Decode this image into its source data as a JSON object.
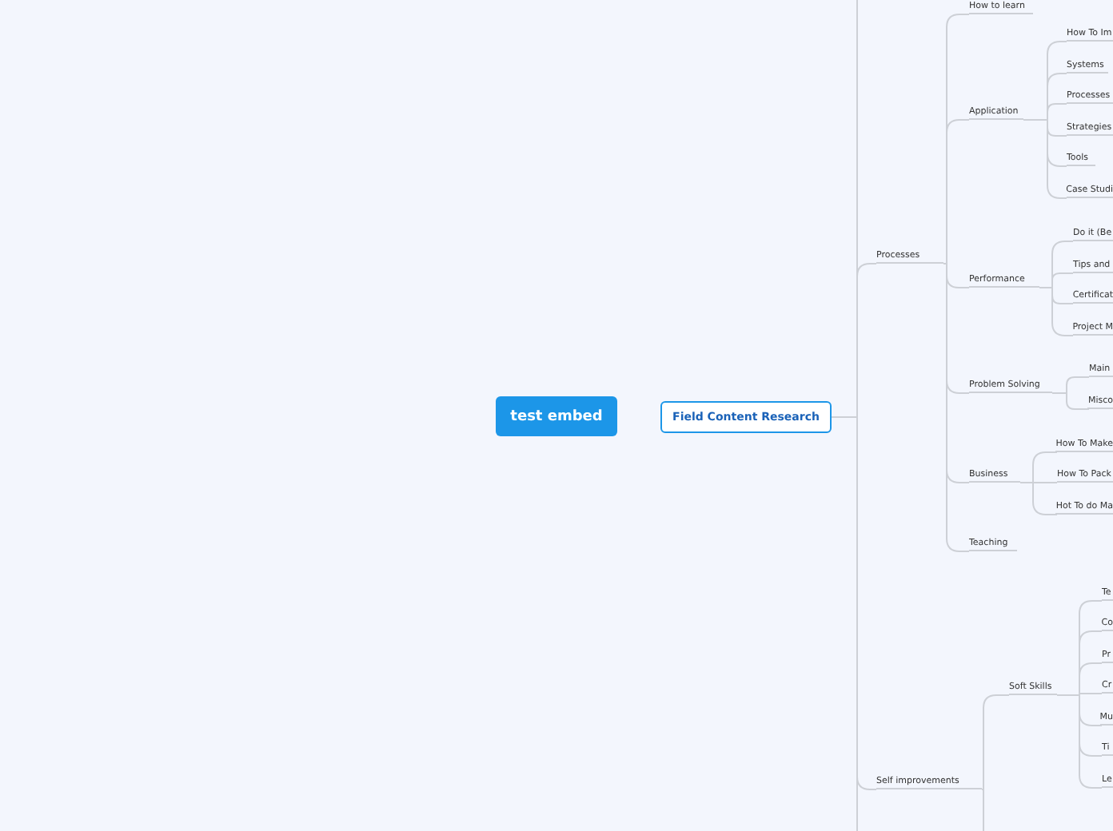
{
  "central_topic": {
    "label": "test embed"
  },
  "main_topic": {
    "label": "Field Content Research",
    "children": [
      {
        "label": "Processes",
        "children": [
          {
            "label": "How to learn"
          },
          {
            "label": "Application",
            "children": [
              {
                "label": "How To Im"
              },
              {
                "label": "Systems"
              },
              {
                "label": "Processes"
              },
              {
                "label": "Strategies"
              },
              {
                "label": "Tools"
              },
              {
                "label": "Case Studi"
              }
            ]
          },
          {
            "label": "Performance",
            "children": [
              {
                "label": "Do it (Be"
              },
              {
                "label": "Tips and"
              },
              {
                "label": "Certificat"
              },
              {
                "label": "Project M"
              }
            ]
          },
          {
            "label": "Problem Solving",
            "children": [
              {
                "label": "Main"
              },
              {
                "label": "Misco"
              }
            ]
          },
          {
            "label": "Business",
            "children": [
              {
                "label": "How To Make"
              },
              {
                "label": "How To Pack"
              },
              {
                "label": "Hot To do Ma"
              }
            ]
          },
          {
            "label": "Teaching"
          }
        ]
      },
      {
        "label": "Self improvements",
        "children": [
          {
            "label": "Soft Skills",
            "children": [
              {
                "label": "Te"
              },
              {
                "label": "Co"
              },
              {
                "label": "Pr"
              },
              {
                "label": "Cr"
              },
              {
                "label": "Mu"
              },
              {
                "label": "Ti"
              },
              {
                "label": "Le"
              }
            ]
          }
        ]
      }
    ]
  }
}
